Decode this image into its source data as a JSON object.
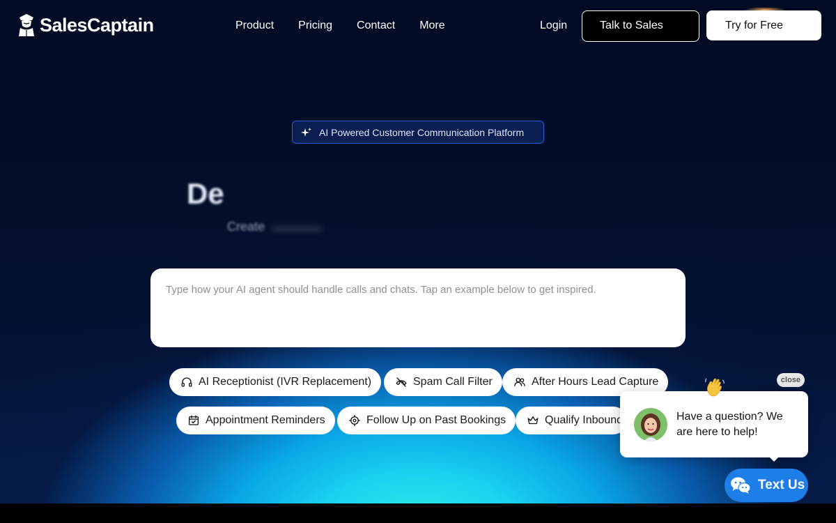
{
  "brand": {
    "name": "SalesCaptain"
  },
  "nav": {
    "items": [
      {
        "label": "Product"
      },
      {
        "label": "Pricing"
      },
      {
        "label": "Contact"
      },
      {
        "label": "More"
      }
    ],
    "login": "Login",
    "talk_to_sales": "Talk to Sales",
    "try_for_free": "Try for Free"
  },
  "hero": {
    "badge": "AI Powered Customer Communication Platform",
    "headline_visible": "De",
    "subline_visible": "Create",
    "prompt_placeholder": "Type how your AI agent should handle calls and chats. Tap an example below to get inspired."
  },
  "examples": [
    {
      "label": "AI Receptionist (IVR Replacement)",
      "icon": "headset-icon"
    },
    {
      "label": "Spam Call Filter",
      "icon": "phone-off-icon"
    },
    {
      "label": "After Hours Lead Capture",
      "icon": "users-icon"
    },
    {
      "label": "Appointment Reminders",
      "icon": "calendar-check-icon"
    },
    {
      "label": "Follow Up on Past Bookings",
      "icon": "target-icon"
    },
    {
      "label": "Qualify Inbound",
      "icon": "crown-icon"
    }
  ],
  "chat_widget": {
    "close_label": "close",
    "message": "Have a question? We are here to help!",
    "button_label": "Text Us",
    "accent_color": "#1c7ee6"
  }
}
